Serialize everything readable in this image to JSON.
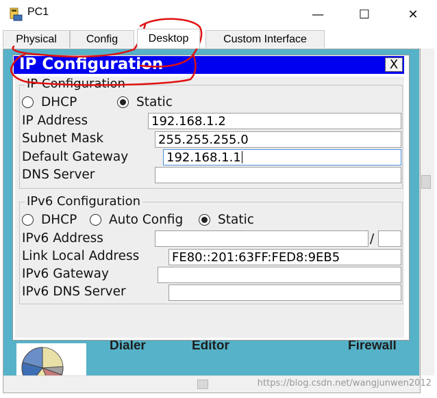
{
  "window": {
    "title": "PC1",
    "controls": {
      "minimize": "—",
      "maximize": "☐",
      "close": "✕"
    }
  },
  "tabs": [
    {
      "label": "Physical"
    },
    {
      "label": "Config"
    },
    {
      "label": "Desktop",
      "active": true
    },
    {
      "label": "Custom Interface"
    }
  ],
  "desktop": {
    "labels": [
      "Dialer",
      "Editor",
      "Firewall"
    ]
  },
  "ip_dialog": {
    "title": "IP Configuration",
    "close_label": "X",
    "ipv4": {
      "group_title": "IP Configuration",
      "mode_options": [
        "DHCP",
        "Static"
      ],
      "selected_mode": "Static",
      "ip_address_label": "IP Address",
      "ip_address": "192.168.1.2",
      "subnet_mask_label": "Subnet Mask",
      "subnet_mask": "255.255.255.0",
      "gateway_label": "Default Gateway",
      "gateway": "192.168.1.1",
      "dns_label": "DNS Server",
      "dns": ""
    },
    "ipv6": {
      "group_title": "IPv6 Configuration",
      "mode_options": [
        "DHCP",
        "Auto Config",
        "Static"
      ],
      "selected_mode": "Static",
      "address_label": "IPv6 Address",
      "address": "",
      "prefix_separator": "/",
      "prefix": "",
      "link_local_label": "Link Local Address",
      "link_local": "FE80::201:63FF:FED8:9EB5",
      "gateway_label": "IPv6 Gateway",
      "gateway": "",
      "dns_label": "IPv6 DNS Server",
      "dns": ""
    }
  },
  "watermark": "https://blog.csdn.net/wangjunwen2012",
  "colors": {
    "title_blue": "#0000f0",
    "desktop_teal": "#55b2c8",
    "annotation_red": "#e01010"
  }
}
